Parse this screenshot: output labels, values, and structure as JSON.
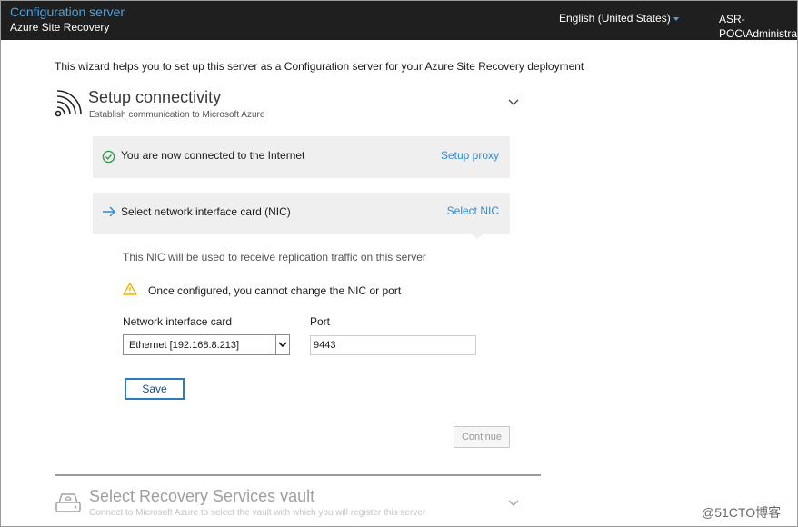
{
  "header": {
    "title": "Configuration server",
    "subtitle": "Azure Site Recovery",
    "language": "English (United States)",
    "user_line1": "ASR-",
    "user_line2": "POC\\Administrat"
  },
  "intro": "This wizard helps you to set up this server as a Configuration server for your Azure Site Recovery deployment",
  "section": {
    "title": "Setup connectivity",
    "subtitle": "Establish communication to Microsoft Azure",
    "icon": "wifi-signal-icon"
  },
  "steps": [
    {
      "label": "You are now connected to the Internet",
      "action": "Setup proxy",
      "status": "done"
    },
    {
      "label": "Select network interface card (NIC)",
      "action": "Select NIC",
      "status": "current"
    }
  ],
  "nic": {
    "description": "This NIC will be used to receive replication traffic on this server",
    "warning": "Once configured, you cannot change the NIC or port",
    "nic_label": "Network interface card",
    "nic_value": "Ethernet [192.168.8.213]",
    "port_label": "Port",
    "port_value": "9443",
    "save_label": "Save"
  },
  "continue_label": "Continue",
  "next_section": {
    "title": "Select Recovery Services vault",
    "subtitle": "Connect to Microsoft Azure to select the vault with which you will register this server",
    "icon": "vault-drive-icon"
  },
  "watermark": "@51CTO博客",
  "colors": {
    "header_bg": "#1f1f1f",
    "accent": "#2e8bd6",
    "success": "#2e9e4f",
    "warning": "#f0b400",
    "panel_bg": "#efefef"
  }
}
